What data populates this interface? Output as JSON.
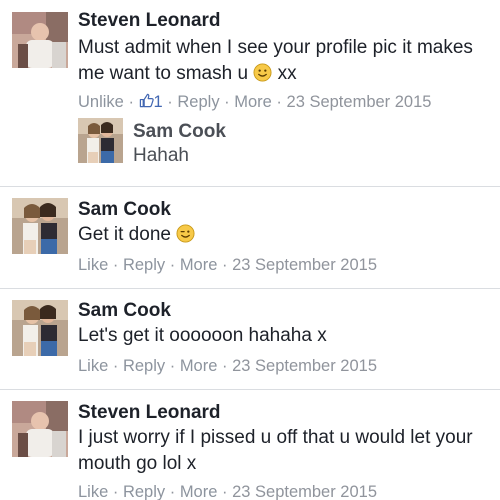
{
  "comments": [
    {
      "author": "Steven Leonard",
      "text_before_emoji": "Must admit when I see your profile pic it makes me want to smash u ",
      "emoji": "smile-emoji",
      "text_after_emoji": " xx",
      "actions": {
        "like_label": "Unlike",
        "like_count": "1",
        "reply_label": "Reply",
        "more_label": "More",
        "date": "23 September 2015"
      },
      "reply": {
        "author": "Sam Cook",
        "text": "Hahah"
      }
    },
    {
      "author": "Sam Cook",
      "text": "Get it done ",
      "emoji": "wink-emoji",
      "actions": {
        "like_label": "Like",
        "reply_label": "Reply",
        "more_label": "More",
        "date": "23 September 2015"
      }
    },
    {
      "author": "Sam Cook",
      "text": "Let's get it oooooon hahaha x",
      "actions": {
        "like_label": "Like",
        "reply_label": "Reply",
        "more_label": "More",
        "date": "23 September 2015"
      }
    },
    {
      "author": "Steven Leonard",
      "text": "I just worry if I pissed u off that u would let your mouth go lol x",
      "actions": {
        "like_label": "Like",
        "reply_label": "Reply",
        "more_label": "More",
        "date": "23 September 2015"
      }
    }
  ],
  "separator": " · ",
  "colors": {
    "name": "#1d2129",
    "meta": "#90949c",
    "like_blue": "#4267b2",
    "divider": "#dadde1",
    "emoji_yellow": "#f7c948"
  }
}
